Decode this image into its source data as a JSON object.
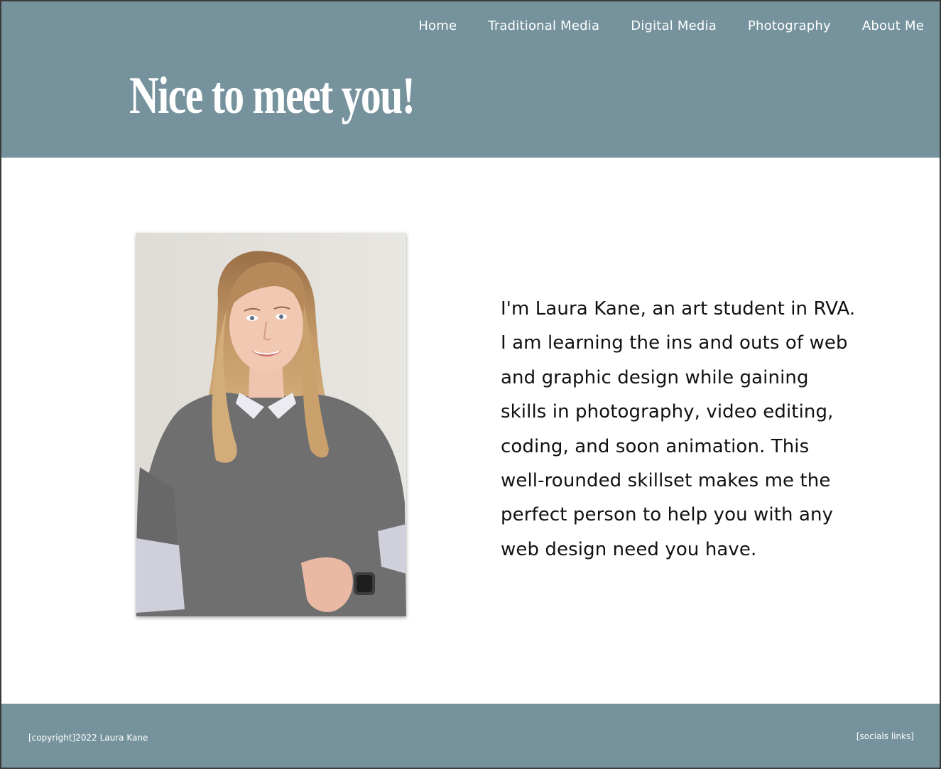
{
  "nav": {
    "items": [
      {
        "label": "Home"
      },
      {
        "label": "Traditional Media"
      },
      {
        "label": "Digital Media"
      },
      {
        "label": "Photography"
      },
      {
        "label": "About Me"
      }
    ]
  },
  "header": {
    "title": "Nice to meet you!"
  },
  "main": {
    "bio": "I'm Laura Kane, an art student in RVA. I am learning the ins and outs of web and graphic design while gaining skills in photography, video editing, coding, and soon animation. This well-rounded skillset makes me the perfect person to help you with any web design need you have."
  },
  "footer": {
    "copyright": "[copyright]2022 Laura Kane",
    "socials": "[socials links]"
  },
  "colors": {
    "brand": "#76939d",
    "text": "#111111",
    "background": "#ffffff"
  }
}
